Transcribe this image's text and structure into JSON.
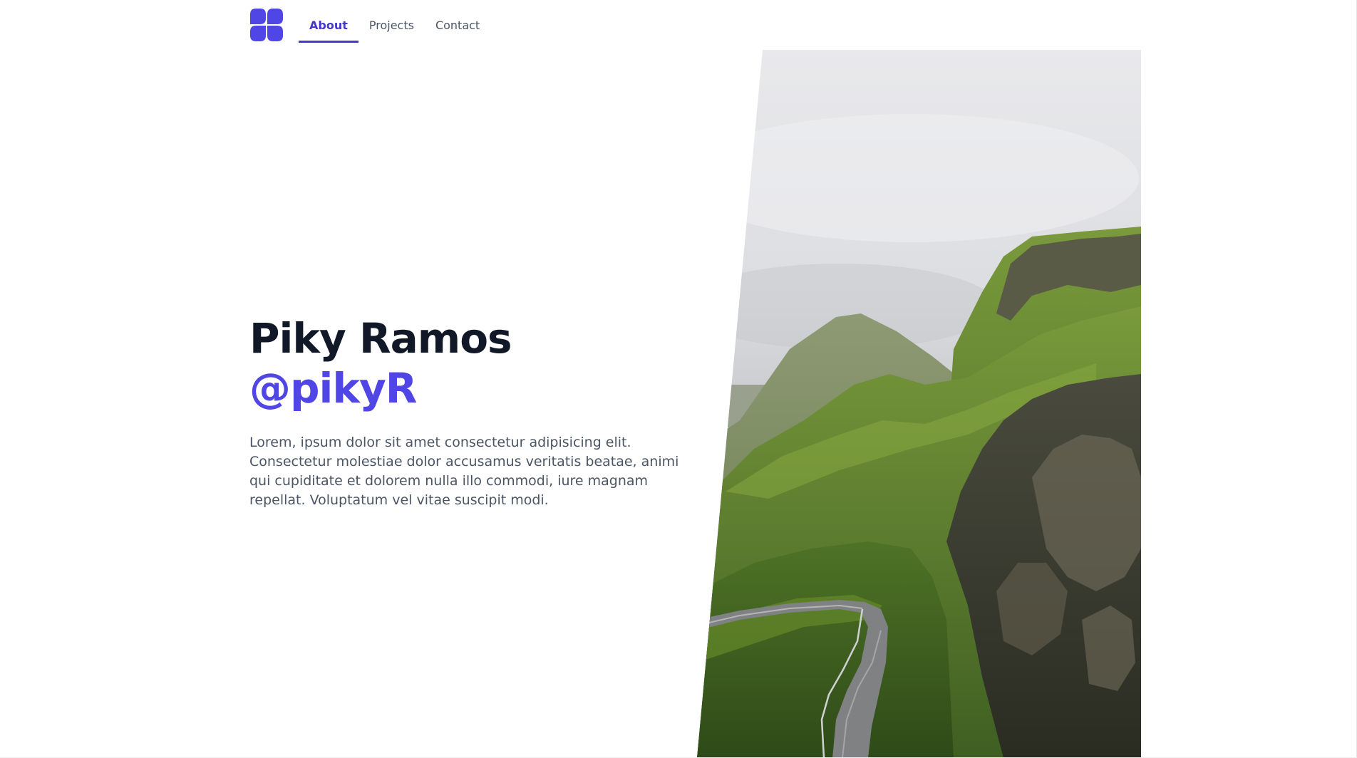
{
  "nav": {
    "items": [
      {
        "label": "About",
        "active": true
      },
      {
        "label": "Projects",
        "active": false
      },
      {
        "label": "Contact",
        "active": false
      }
    ]
  },
  "hero": {
    "name": "Piky Ramos",
    "handle": "@pikyR",
    "description": "Lorem, ipsum dolor sit amet consectetur adipisicing elit. Consectetur molestiae dolor accusamus veritatis beatae, animi qui cupiditate et dolorem nulla illo commodi, iure magnam repellat. Voluptatum vel vitae suscipit modi."
  },
  "colors": {
    "accent": "#4f46e5",
    "accent_dark": "#4338ca",
    "heading": "#111827",
    "body_text": "#4b5563"
  },
  "icons": {
    "logo": "four-petal-logo-icon"
  }
}
